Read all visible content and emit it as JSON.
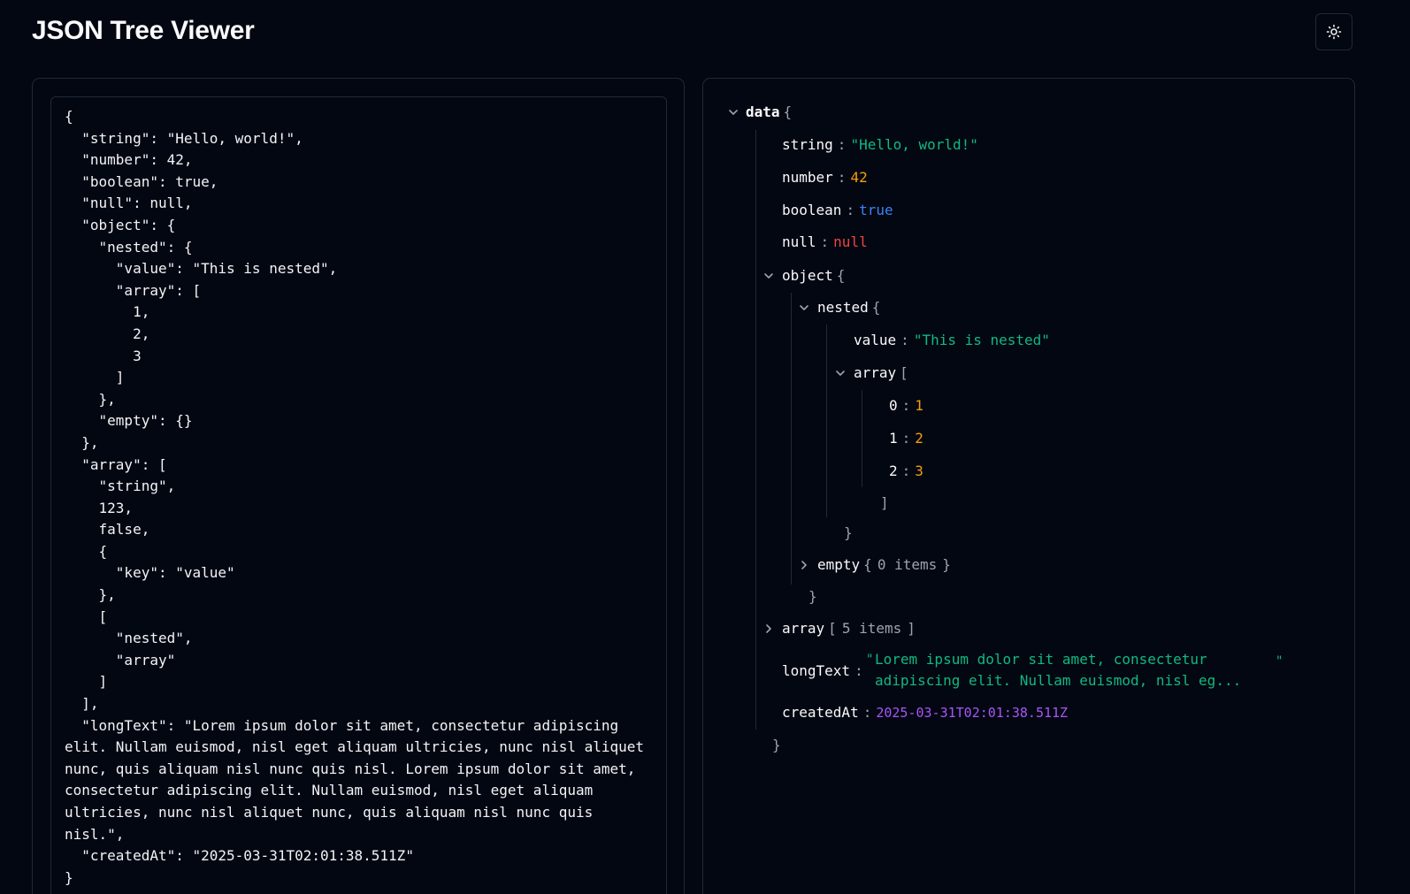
{
  "app": {
    "title": "JSON Tree Viewer",
    "theme_toggle_icon": "sun-icon"
  },
  "editor": {
    "content": "{\n  \"string\": \"Hello, world!\",\n  \"number\": 42,\n  \"boolean\": true,\n  \"null\": null,\n  \"object\": {\n    \"nested\": {\n      \"value\": \"This is nested\",\n      \"array\": [\n        1,\n        2,\n        3\n      ]\n    },\n    \"empty\": {}\n  },\n  \"array\": [\n    \"string\",\n    123,\n    false,\n    {\n      \"key\": \"value\"\n    },\n    [\n      \"nested\",\n      \"array\"\n    ]\n  ],\n  \"longText\": \"Lorem ipsum dolor sit amet, consectetur adipiscing elit. Nullam euismod, nisl eget aliquam ultricies, nunc nisl aliquet nunc, quis aliquam nisl nunc quis nisl. Lorem ipsum dolor sit amet, consectetur adipiscing elit. Nullam euismod, nisl eget aliquam ultricies, nunc nisl aliquet nunc, quis aliquam nisl nunc quis nisl.\",\n  \"createdAt\": \"2025-03-31T02:01:38.511Z\"\n}"
  },
  "tree": {
    "root": {
      "key": "data",
      "open": "{",
      "close": "}"
    },
    "string": {
      "key": "string",
      "value": "\"Hello, world!\""
    },
    "number": {
      "key": "number",
      "value": "42"
    },
    "boolean": {
      "key": "boolean",
      "value": "true"
    },
    "null": {
      "key": "null",
      "value": "null"
    },
    "object": {
      "key": "object",
      "open": "{",
      "close": "}",
      "nested": {
        "key": "nested",
        "open": "{",
        "close": "}",
        "value": {
          "key": "value",
          "value": "\"This is nested\""
        },
        "array": {
          "key": "array",
          "open": "[",
          "close": "]",
          "items": [
            {
              "key": "0",
              "value": "1"
            },
            {
              "key": "1",
              "value": "2"
            },
            {
              "key": "2",
              "value": "3"
            }
          ]
        }
      },
      "empty": {
        "key": "empty",
        "open": "{",
        "summary": "0 items",
        "close": "}"
      }
    },
    "array": {
      "key": "array",
      "open": "[",
      "summary": "5 items",
      "close": "]"
    },
    "longText": {
      "key": "longText",
      "open_quote": "\"",
      "value": "Lorem ipsum dolor sit amet, consectetur adipiscing elit. Nullam euismod, nisl eg...",
      "close_quote": "\""
    },
    "createdAt": {
      "key": "createdAt",
      "value": "2025-03-31T02:01:38.511Z"
    },
    "colon": ":"
  },
  "colors": {
    "background": "#030712",
    "border": "#1f2937",
    "string": "#10b981",
    "number": "#f59e0b",
    "boolean": "#3b82f6",
    "null": "#ef4444",
    "date": "#a855f7",
    "punctuation": "#9ca3af"
  }
}
